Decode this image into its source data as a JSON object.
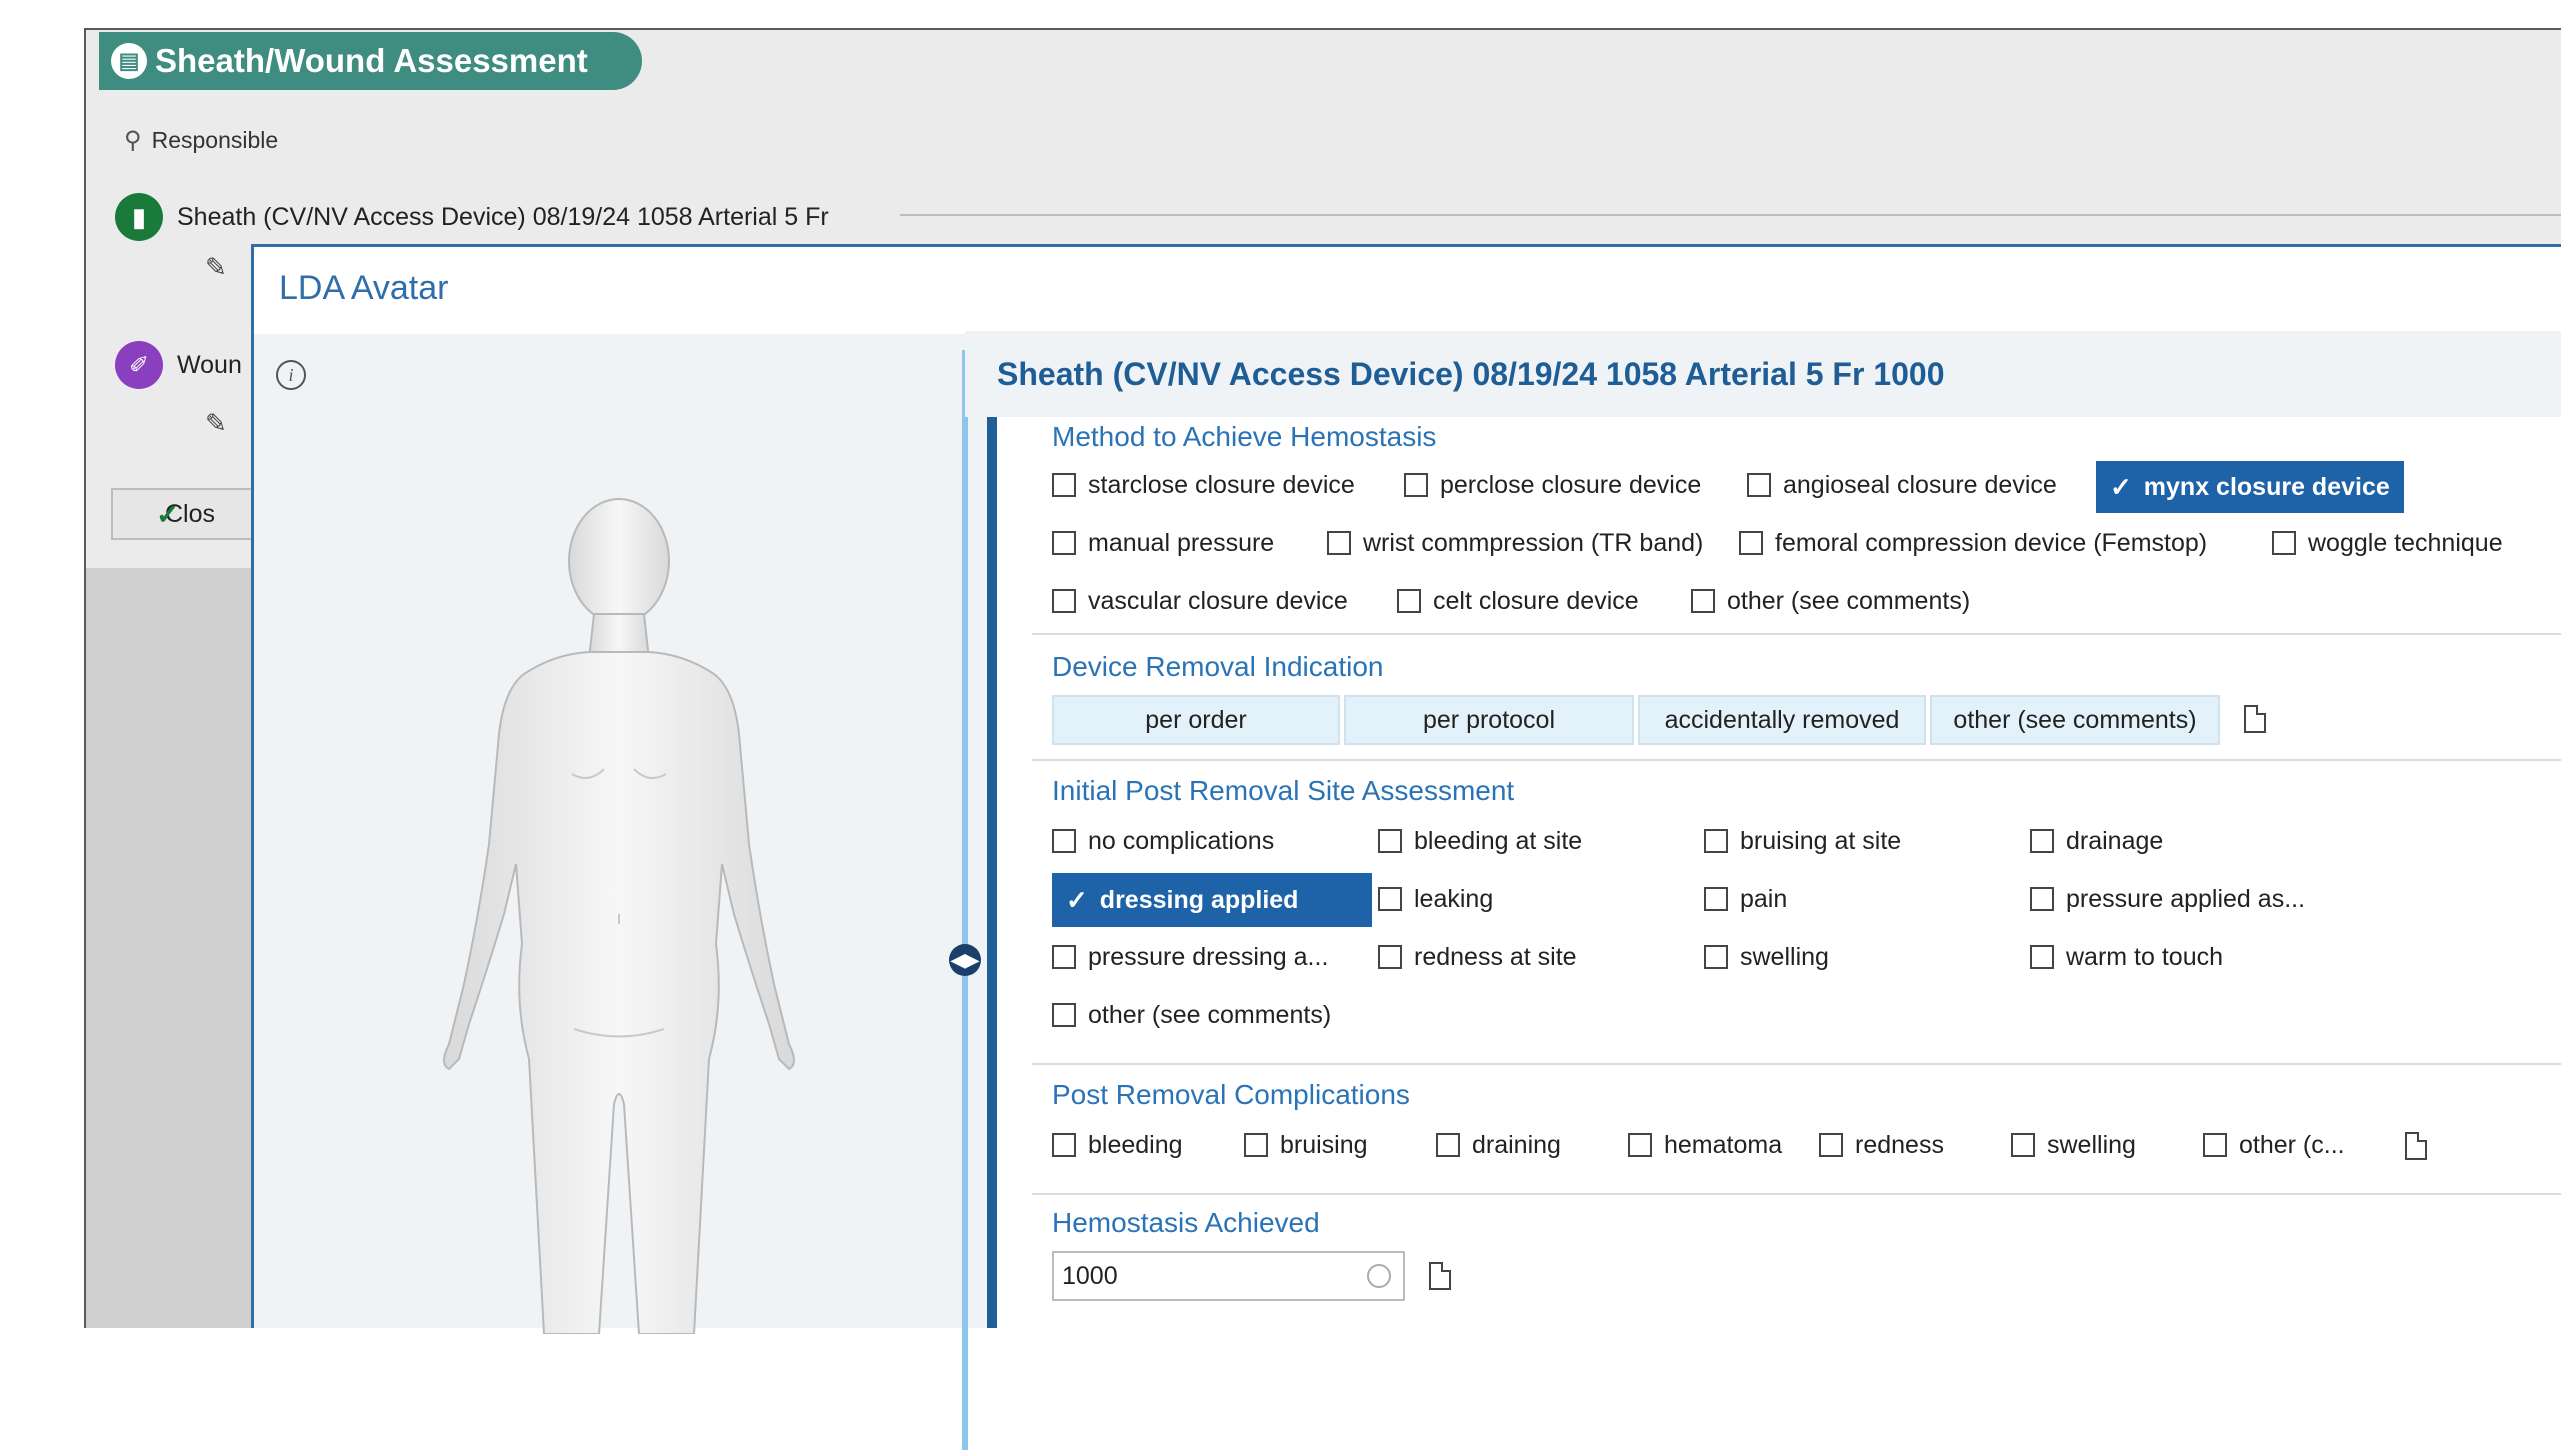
{
  "header": {
    "title": "Sheath/Wound Assessment",
    "responsible": "Responsible",
    "device": "Sheath (CV/NV Access Device) 08/19/24 1058 Arterial 5 Fr",
    "wound": "Woun",
    "close_label": "Clos"
  },
  "modal": {
    "title": "LDA Avatar",
    "panel_title": "Sheath (CV/NV Access Device) 08/19/24 1058 Arterial 5 Fr 1000"
  },
  "hemostasis_method": {
    "title": "Method to Achieve Hemostasis",
    "options": [
      {
        "label": "starclose closure device",
        "checked": false
      },
      {
        "label": "perclose closure device",
        "checked": false
      },
      {
        "label": "angioseal closure device",
        "checked": false
      },
      {
        "label": "mynx closure device",
        "checked": true
      },
      {
        "label": "manual pressure",
        "checked": false
      },
      {
        "label": "wrist commpression (TR band)",
        "checked": false
      },
      {
        "label": "femoral compression device (Femstop)",
        "checked": false
      },
      {
        "label": "woggle technique",
        "checked": false
      },
      {
        "label": "vascular closure device",
        "checked": false
      },
      {
        "label": "celt closure device",
        "checked": false
      },
      {
        "label": "other (see comments)",
        "checked": false
      }
    ]
  },
  "removal_indication": {
    "title": "Device Removal Indication",
    "options": [
      "per order",
      "per protocol",
      "accidentally removed",
      "other (see comments)"
    ]
  },
  "site_assessment": {
    "title": "Initial Post Removal Site Assessment",
    "options": [
      {
        "label": "no complications",
        "checked": false
      },
      {
        "label": "bleeding at site",
        "checked": false
      },
      {
        "label": "bruising at site",
        "checked": false
      },
      {
        "label": "drainage",
        "checked": false
      },
      {
        "label": "dressing applied",
        "checked": true
      },
      {
        "label": "leaking",
        "checked": false
      },
      {
        "label": "pain",
        "checked": false
      },
      {
        "label": "pressure applied as...",
        "checked": false
      },
      {
        "label": "pressure dressing a...",
        "checked": false
      },
      {
        "label": "redness at site",
        "checked": false
      },
      {
        "label": "swelling",
        "checked": false
      },
      {
        "label": "warm to touch",
        "checked": false
      },
      {
        "label": "other (see comments)",
        "checked": false
      }
    ]
  },
  "complications": {
    "title": "Post Removal Complications",
    "options": [
      {
        "label": "bleeding",
        "checked": false
      },
      {
        "label": "bruising",
        "checked": false
      },
      {
        "label": "draining",
        "checked": false
      },
      {
        "label": "hematoma",
        "checked": false
      },
      {
        "label": "redness",
        "checked": false
      },
      {
        "label": "swelling",
        "checked": false
      },
      {
        "label": "other (c...",
        "checked": false
      }
    ]
  },
  "hemostasis_achieved": {
    "title": "Hemostasis Achieved",
    "value": "1000"
  },
  "colors": {
    "accent": "#2a73b6",
    "selected": "#1e63a8",
    "title_pill": "#3e8d80"
  }
}
